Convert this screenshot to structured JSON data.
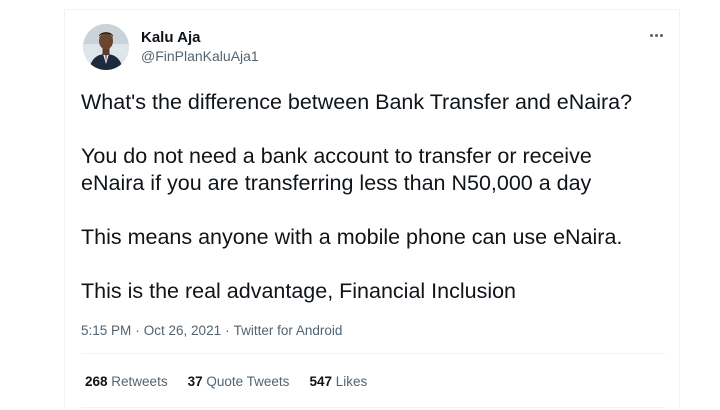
{
  "author": {
    "display_name": "Kalu Aja",
    "handle": "@FinPlanKaluAja1",
    "avatar_icon": "profile-photo"
  },
  "more_icon": "more-options-icon",
  "tweet": {
    "paragraphs": [
      [
        "What's the difference between Bank Transfer and eNaira?"
      ],
      [
        "You do not need a bank account to transfer or receive",
        "eNaira if you are transferring less than N50,000 a day"
      ],
      [
        "This means anyone with a mobile phone can use eNaira."
      ],
      [
        "This is the real advantage, Financial Inclusion"
      ]
    ]
  },
  "meta": {
    "time": "5:15 PM",
    "date": "Oct 26, 2021",
    "source": "Twitter for Android",
    "separator": "·"
  },
  "stats": {
    "retweets": {
      "count": "268",
      "label": "Retweets"
    },
    "quotes": {
      "count": "37",
      "label": "Quote Tweets"
    },
    "likes": {
      "count": "547",
      "label": "Likes"
    }
  },
  "colors": {
    "text_primary": "#0f1419",
    "text_secondary": "#536471",
    "border": "#eff3f4"
  }
}
